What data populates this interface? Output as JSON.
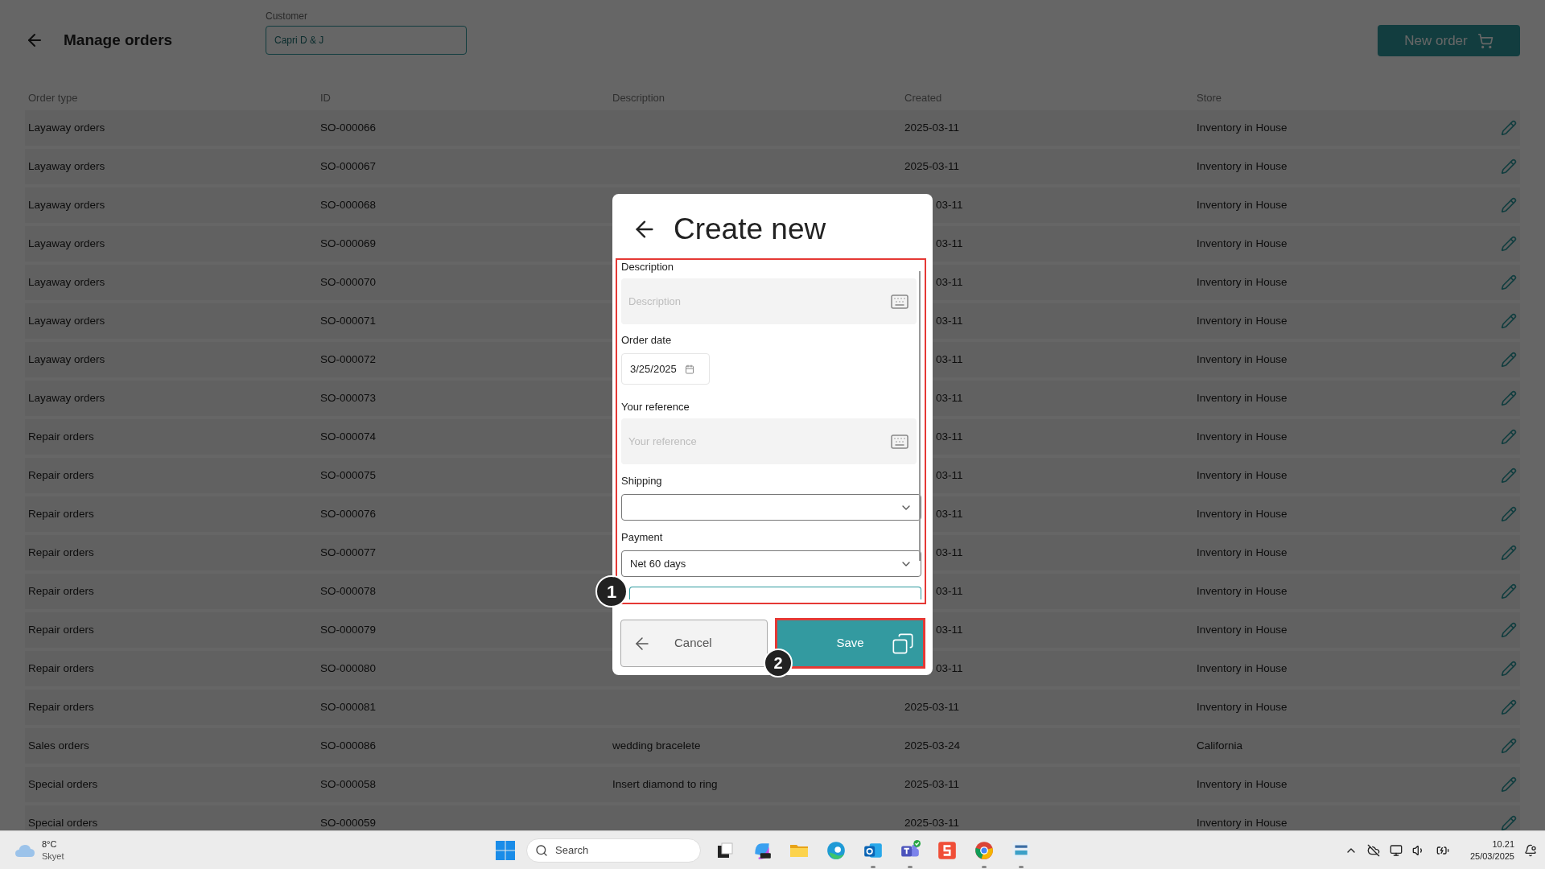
{
  "header": {
    "title": "Manage orders",
    "customer": {
      "label": "Customer",
      "value": "Capri D & J"
    },
    "new_order_button": "New order"
  },
  "table": {
    "columns": [
      "Order type",
      "ID",
      "Description",
      "Created",
      "Store"
    ],
    "rows": [
      {
        "order_type": "Layaway orders",
        "id": "SO-000066",
        "created": "2025-03-11",
        "store": "Inventory in House",
        "covered": false
      },
      {
        "order_type": "Layaway orders",
        "id": "SO-000067",
        "created": "2025-03-11",
        "store": "Inventory in House",
        "covered": false
      },
      {
        "order_type": "Layaway orders",
        "id": "SO-000068",
        "created": "03-11",
        "store": "Inventory in House",
        "covered": true
      },
      {
        "order_type": "Layaway orders",
        "id": "SO-000069",
        "created": "03-11",
        "store": "Inventory in House",
        "covered": true
      },
      {
        "order_type": "Layaway orders",
        "id": "SO-000070",
        "created": "03-11",
        "store": "Inventory in House",
        "covered": true
      },
      {
        "order_type": "Layaway orders",
        "id": "SO-000071",
        "created": "03-11",
        "store": "Inventory in House",
        "covered": true
      },
      {
        "order_type": "Layaway orders",
        "id": "SO-000072",
        "created": "03-11",
        "store": "Inventory in House",
        "covered": true
      },
      {
        "order_type": "Layaway orders",
        "id": "SO-000073",
        "created": "03-11",
        "store": "Inventory in House",
        "covered": true
      },
      {
        "order_type": "Repair orders",
        "id": "SO-000074",
        "created": "03-11",
        "store": "Inventory in House",
        "covered": true
      },
      {
        "order_type": "Repair orders",
        "id": "SO-000075",
        "created": "03-11",
        "store": "Inventory in House",
        "covered": true
      },
      {
        "order_type": "Repair orders",
        "id": "SO-000076",
        "created": "03-11",
        "store": "Inventory in House",
        "covered": true
      },
      {
        "order_type": "Repair orders",
        "id": "SO-000077",
        "created": "03-11",
        "store": "Inventory in House",
        "covered": true
      },
      {
        "order_type": "Repair orders",
        "id": "SO-000078",
        "created": "03-11",
        "store": "Inventory in House",
        "covered": true
      },
      {
        "order_type": "Repair orders",
        "id": "SO-000079",
        "created": "03-11",
        "store": "Inventory in House",
        "covered": true
      },
      {
        "order_type": "Repair orders",
        "id": "SO-000080",
        "created": "03-11",
        "store": "Inventory in House",
        "covered": true
      },
      {
        "order_type": "Repair orders",
        "id": "SO-000081",
        "created": "2025-03-11",
        "store": "Inventory in House",
        "covered": false
      },
      {
        "order_type": "Sales orders",
        "id": "SO-000086",
        "description": "wedding bracelete",
        "created": "2025-03-24",
        "store": "California",
        "covered": false
      },
      {
        "order_type": "Special orders",
        "id": "SO-000058",
        "description": "Insert diamond to ring",
        "created": "2025-03-11",
        "store": "Inventory in House",
        "covered": false
      },
      {
        "order_type": "Special orders",
        "id": "SO-000059",
        "created": "2025-03-11",
        "store": "Inventory in House",
        "covered": false
      }
    ]
  },
  "dialog": {
    "title": "Create new",
    "fields": [
      {
        "kind": "text",
        "label": "Description",
        "placeholder": "Description"
      },
      {
        "kind": "date",
        "label": "Order date",
        "value": "3/25/2025"
      },
      {
        "kind": "text",
        "label": "Your reference",
        "placeholder": "Your reference"
      },
      {
        "kind": "select",
        "label": "Shipping"
      },
      {
        "kind": "select",
        "label": "Payment",
        "value": "Net 60 days"
      },
      {
        "kind": "cut"
      }
    ],
    "cancel_button": "Cancel",
    "save_button": "Save",
    "annotations": [
      {
        "label": "1"
      },
      {
        "label": "2"
      }
    ]
  },
  "taskbar": {
    "weather": {
      "temperature": "8°C",
      "condition": "Skyet"
    },
    "search": {
      "placeholder": "Search"
    },
    "apps": [
      {
        "kind": "taskview",
        "running": false
      },
      {
        "kind": "copilot",
        "running": false
      },
      {
        "kind": "folder",
        "running": false
      },
      {
        "kind": "edge",
        "running": false
      },
      {
        "kind": "outlook",
        "running": true
      },
      {
        "kind": "teams",
        "running": true
      },
      {
        "kind": "snagit",
        "running": false
      },
      {
        "kind": "chrome",
        "running": true
      },
      {
        "kind": "pos",
        "running": true
      }
    ],
    "time": "10.21",
    "date": "25/03/2025"
  }
}
